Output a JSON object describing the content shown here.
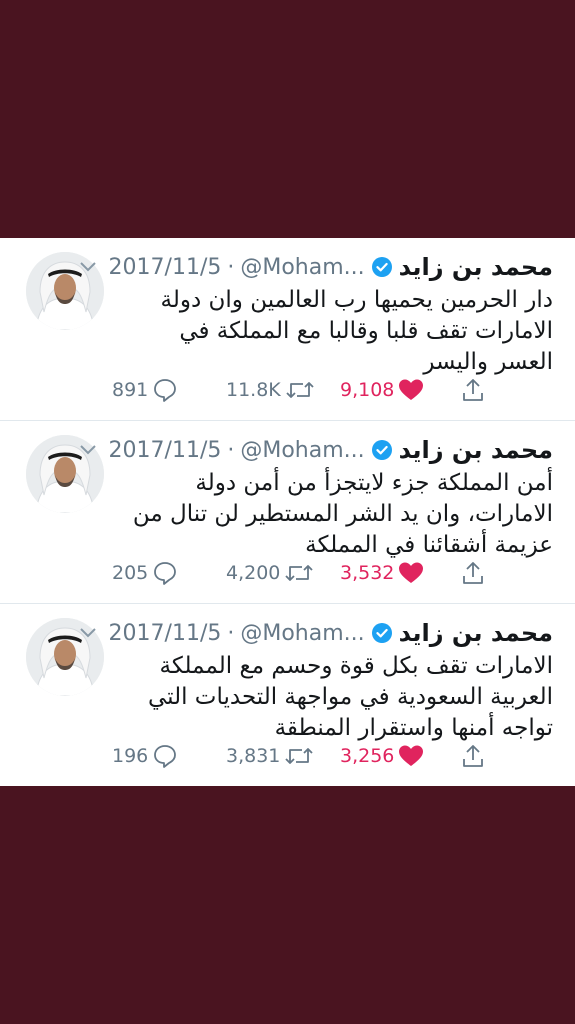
{
  "tweets": [
    {
      "name": "محمد بن زايد",
      "handle": "@Moham...",
      "separator": "·",
      "date": "2017/11/5",
      "text": "دار الحرمين يحميها رب العالمين وان دولة الامارات تقف قلبا وقالبا مع المملكة في العسر واليسر",
      "replies": "891",
      "retweets": "11.8K",
      "likes": "9,108"
    },
    {
      "name": "محمد بن زايد",
      "handle": "@Moham...",
      "separator": "·",
      "date": "2017/11/5",
      "text": "أمن المملكة جزء لايتجزأ من أمن دولة الامارات، وان يد الشر المستطير لن تنال من عزيمة أشقائنا في المملكة",
      "replies": "205",
      "retweets": "4,200",
      "likes": "3,532"
    },
    {
      "name": "محمد بن زايد",
      "handle": "@Moham...",
      "separator": "·",
      "date": "2017/11/5",
      "text": "الامارات تقف بكل قوة وحسم مع المملكة العربية السعودية في مواجهة التحديات التي تواجه أمنها واستقرار المنطقة",
      "replies": "196",
      "retweets": "3,831",
      "likes": "3,256"
    }
  ],
  "icons": {
    "verified": "verified-badge-icon",
    "menu": "chevron-down-icon",
    "reply": "reply-icon",
    "retweet": "retweet-icon",
    "like": "heart-icon",
    "share": "share-icon"
  },
  "colors": {
    "background": "#4a1420",
    "verified": "#1da1f2",
    "like": "#e0245e",
    "muted": "#657786"
  }
}
